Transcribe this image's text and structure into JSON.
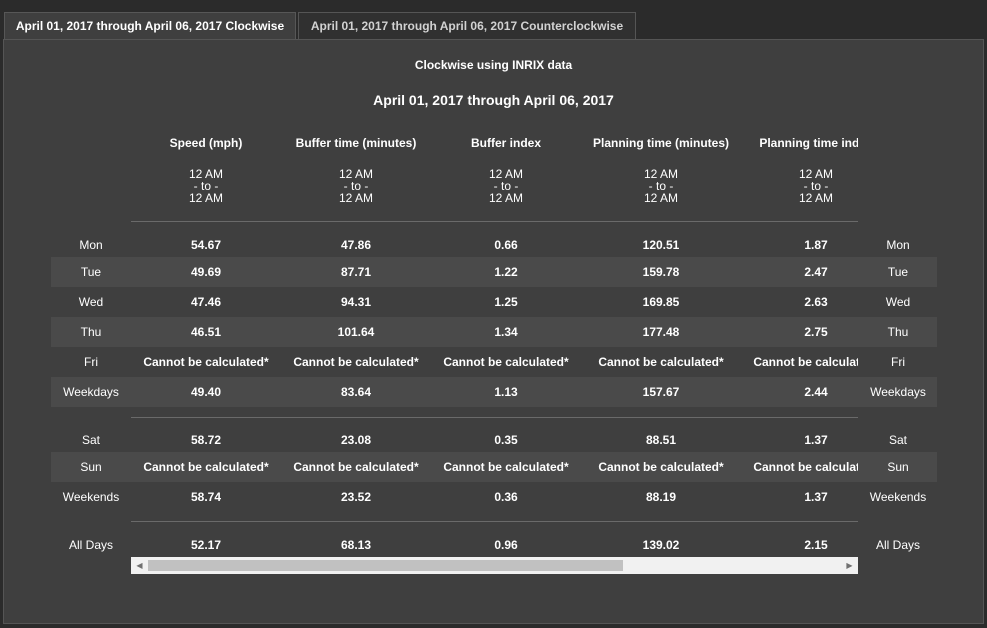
{
  "tabs": [
    {
      "label": "April 01, 2017 through April 06, 2017 Clockwise",
      "active": true
    },
    {
      "label": "April 01, 2017 through April 06, 2017 Counterclockwise",
      "active": false
    }
  ],
  "subtitle": "Clockwise using INRIX data",
  "title": "April 01, 2017 through April 06, 2017",
  "columns": [
    {
      "header": "Speed (mph)",
      "time": [
        "12 AM",
        "- to -",
        "12 AM"
      ]
    },
    {
      "header": "Buffer time (minutes)",
      "time": [
        "12 AM",
        "- to -",
        "12 AM"
      ]
    },
    {
      "header": "Buffer index",
      "time": [
        "12 AM",
        "- to -",
        "12 AM"
      ]
    },
    {
      "header": "Planning time (minutes)",
      "time": [
        "12 AM",
        "- to -",
        "12 AM"
      ]
    },
    {
      "header": "Planning time index",
      "time": [
        "12 AM",
        "- to -",
        "12 AM"
      ]
    }
  ],
  "rows": [
    {
      "day": "Mon",
      "values": [
        "54.67",
        "47.86",
        "0.66",
        "120.51",
        "1.87"
      ]
    },
    {
      "day": "Tue",
      "values": [
        "49.69",
        "87.71",
        "1.22",
        "159.78",
        "2.47"
      ]
    },
    {
      "day": "Wed",
      "values": [
        "47.46",
        "94.31",
        "1.25",
        "169.85",
        "2.63"
      ]
    },
    {
      "day": "Thu",
      "values": [
        "46.51",
        "101.64",
        "1.34",
        "177.48",
        "2.75"
      ]
    },
    {
      "day": "Fri",
      "values": [
        "Cannot be calculated*",
        "Cannot be calculated*",
        "Cannot be calculated*",
        "Cannot be calculated*",
        "Cannot be calculated*"
      ]
    },
    {
      "day": "Weekdays",
      "values": [
        "49.40",
        "83.64",
        "1.13",
        "157.67",
        "2.44"
      ]
    },
    {
      "day": "Sat",
      "values": [
        "58.72",
        "23.08",
        "0.35",
        "88.51",
        "1.37"
      ]
    },
    {
      "day": "Sun",
      "values": [
        "Cannot be calculated*",
        "Cannot be calculated*",
        "Cannot be calculated*",
        "Cannot be calculated*",
        "Cannot be calculated*"
      ]
    },
    {
      "day": "Weekends",
      "values": [
        "58.74",
        "23.52",
        "0.36",
        "88.19",
        "1.37"
      ]
    },
    {
      "day": "All Days",
      "values": [
        "52.17",
        "68.13",
        "0.96",
        "139.02",
        "2.15"
      ]
    }
  ],
  "scrollbar": {
    "left_arrow": "◀",
    "right_arrow": "▶",
    "position_fraction": 0
  }
}
